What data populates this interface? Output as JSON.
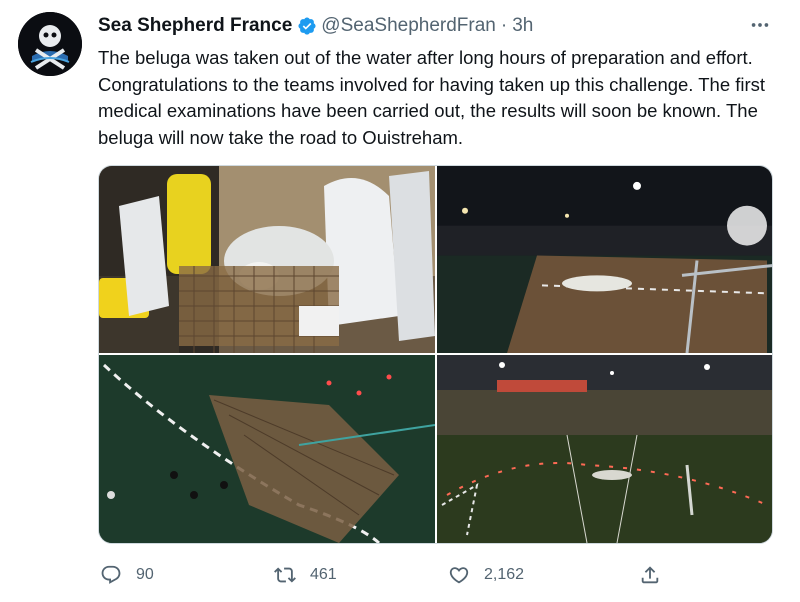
{
  "tweet": {
    "author": {
      "display_name": "Sea Shepherd France",
      "handle": "@SeaShepherdFran",
      "separator": "·",
      "time": "3h",
      "verified": true
    },
    "text": "The beluga was taken out of the water after long hours of preparation and effort. Congratulations to the teams involved for having taken up this challenge. The first medical examinations have been carried out, the results will soon be known. The beluga will now take the road to Ouistreham.",
    "media": [
      {
        "subject": "beluga-on-net-with-team-in-white-suits"
      },
      {
        "subject": "night-lock-with-net-and-beluga"
      },
      {
        "subject": "divers-and-net-in-dark-water"
      },
      {
        "subject": "lock-basin-at-night-with-beluga"
      }
    ],
    "actions": {
      "reply_count": "90",
      "retweet_count": "461",
      "like_count": "2,162"
    }
  },
  "icons": {
    "more": "more-horizontal-icon",
    "verified": "verified-badge-icon",
    "reply": "reply-icon",
    "retweet": "retweet-icon",
    "like": "heart-icon",
    "share": "share-icon"
  },
  "colors": {
    "verified": "#1d9bf0",
    "text_primary": "#0f1419",
    "text_secondary": "#536471"
  }
}
